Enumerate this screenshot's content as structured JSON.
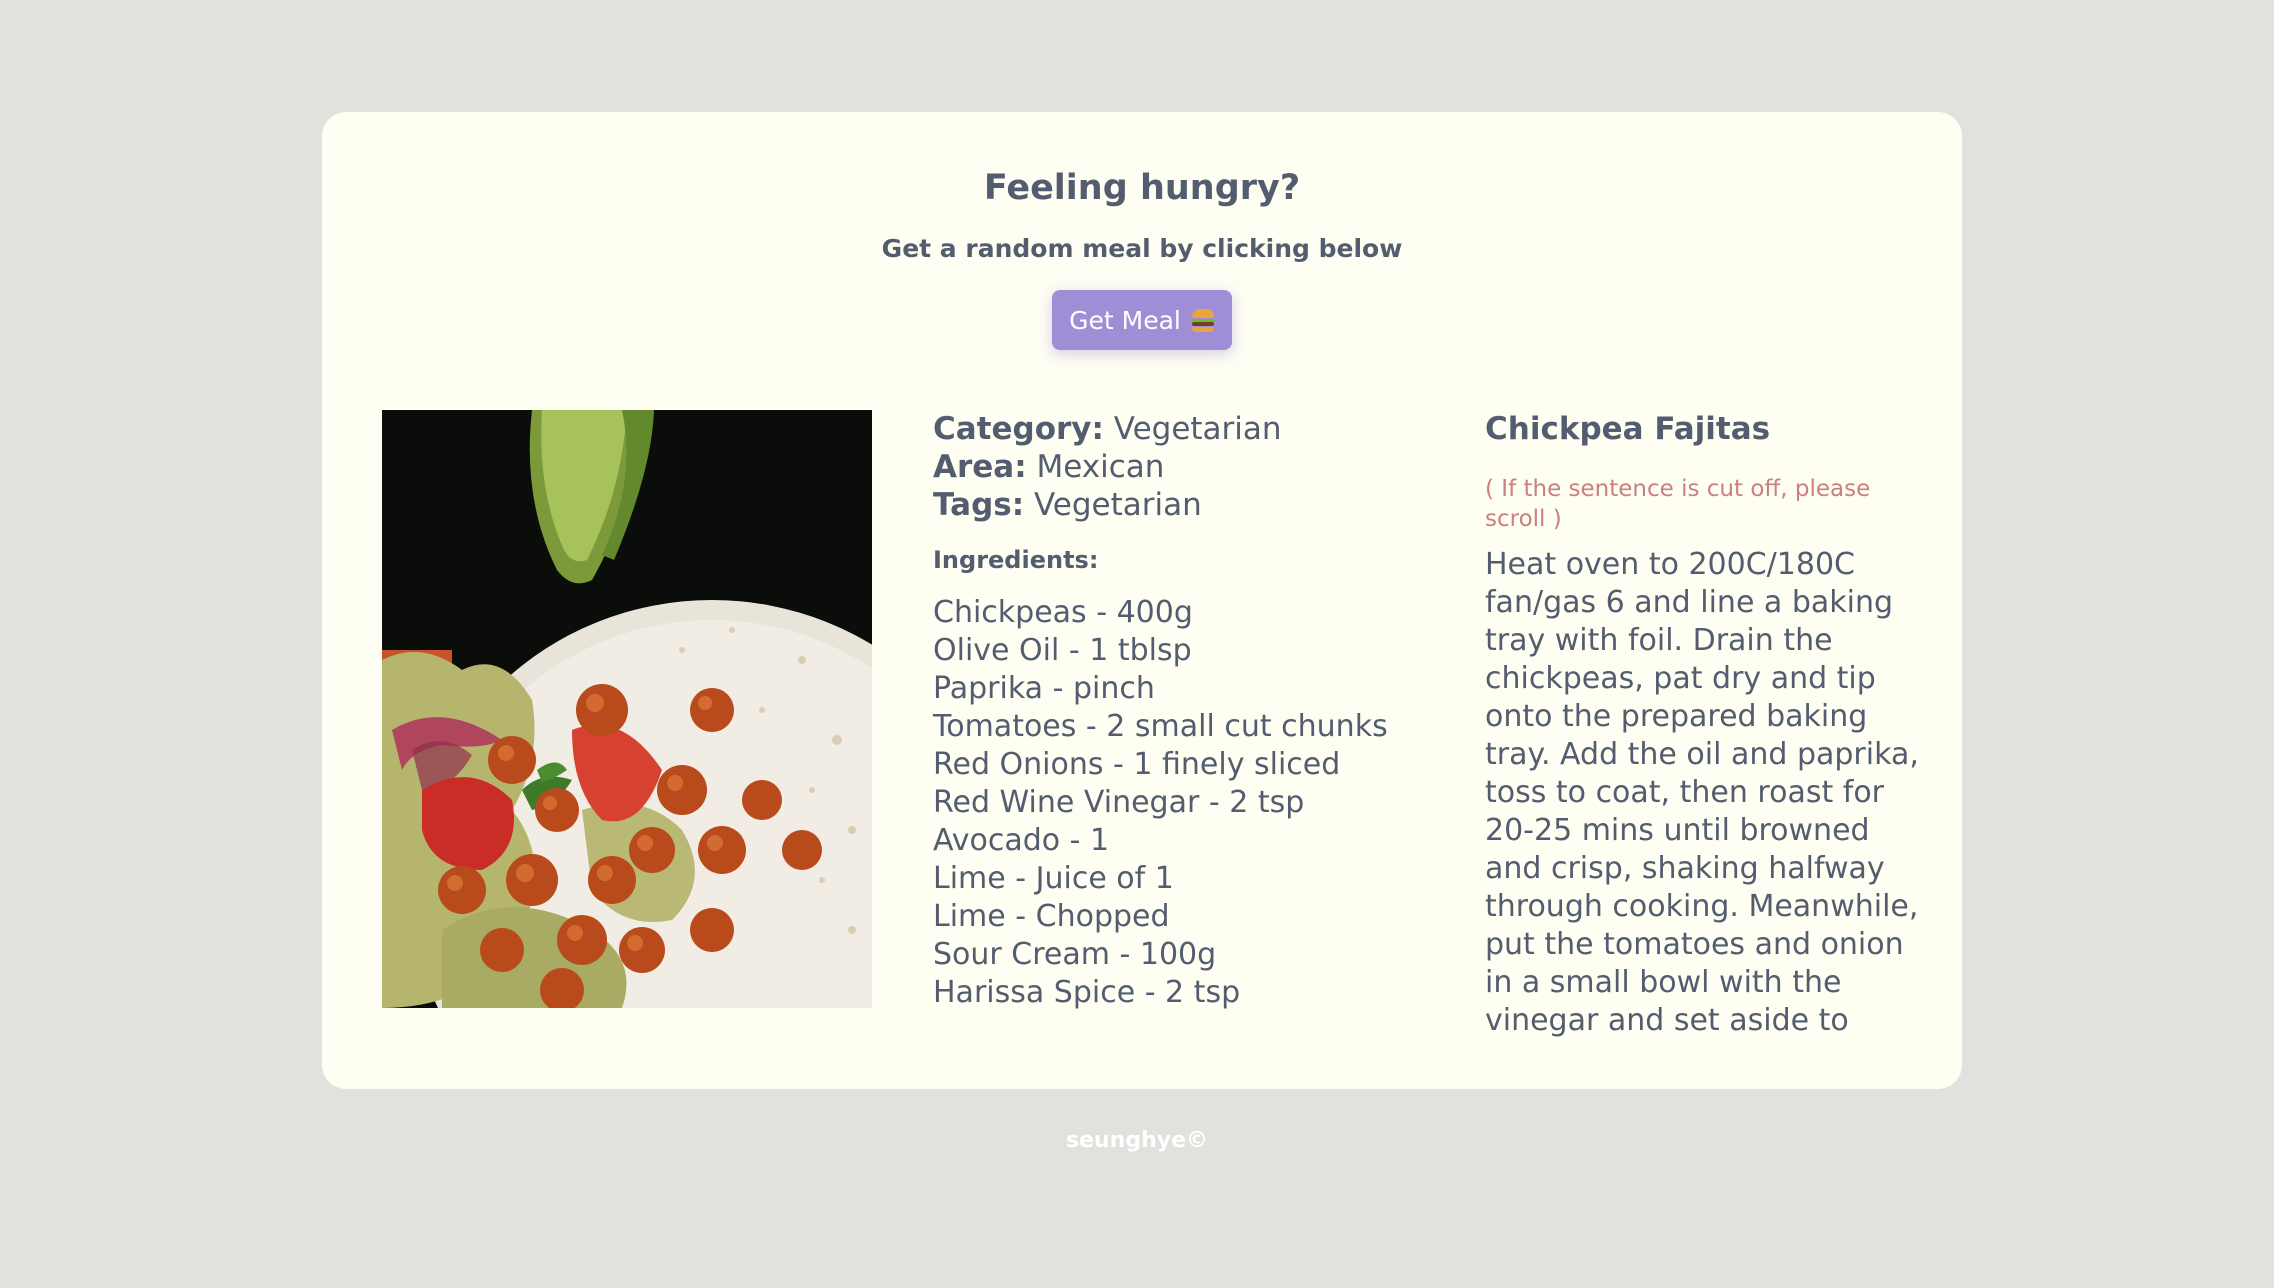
{
  "header": {
    "title": "Feeling hungry?",
    "subtitle": "Get a random meal by clicking below",
    "button_label": "Get Meal",
    "button_icon": "burger-emoji"
  },
  "meal": {
    "category_label": "Category:",
    "category": "Vegetarian",
    "area_label": "Area:",
    "area": "Mexican",
    "tags_label": "Tags:",
    "tags": "Vegetarian",
    "ingredients_heading": "Ingredients:",
    "ingredients": [
      "Chickpeas - 400g",
      "Olive Oil - 1 tblsp",
      "Paprika - pinch",
      "Tomatoes - 2 small cut chunks",
      "Red Onions - 1 finely sliced",
      "Red Wine Vinegar - 2 tsp",
      "Avocado - 1",
      "Lime - Juice of 1",
      "Lime - Chopped",
      "Sour Cream - 100g",
      "Harissa Spice - 2 tsp"
    ],
    "name": "Chickpea Fajitas",
    "scroll_note": "( If the sentence is cut off, please scroll )",
    "instructions": "Heat oven to 200C/180C fan/gas 6 and line a baking tray with foil. Drain the chickpeas, pat dry and tip onto the prepared baking tray. Add the oil and paprika, toss to coat, then roast for 20-25 mins until browned and crisp, shaking halfway through cooking. Meanwhile, put the tomatoes and onion in a small bowl with the vinegar and set aside to pickle. Put the avocado in another bowl and mash with the lime juice."
  },
  "footer": {
    "text": "seunghye©"
  },
  "colors": {
    "background": "#e1e2dd",
    "card": "#fefef3",
    "button": "#9f8ed6",
    "text": "#535d6f",
    "note": "#c9807e"
  }
}
